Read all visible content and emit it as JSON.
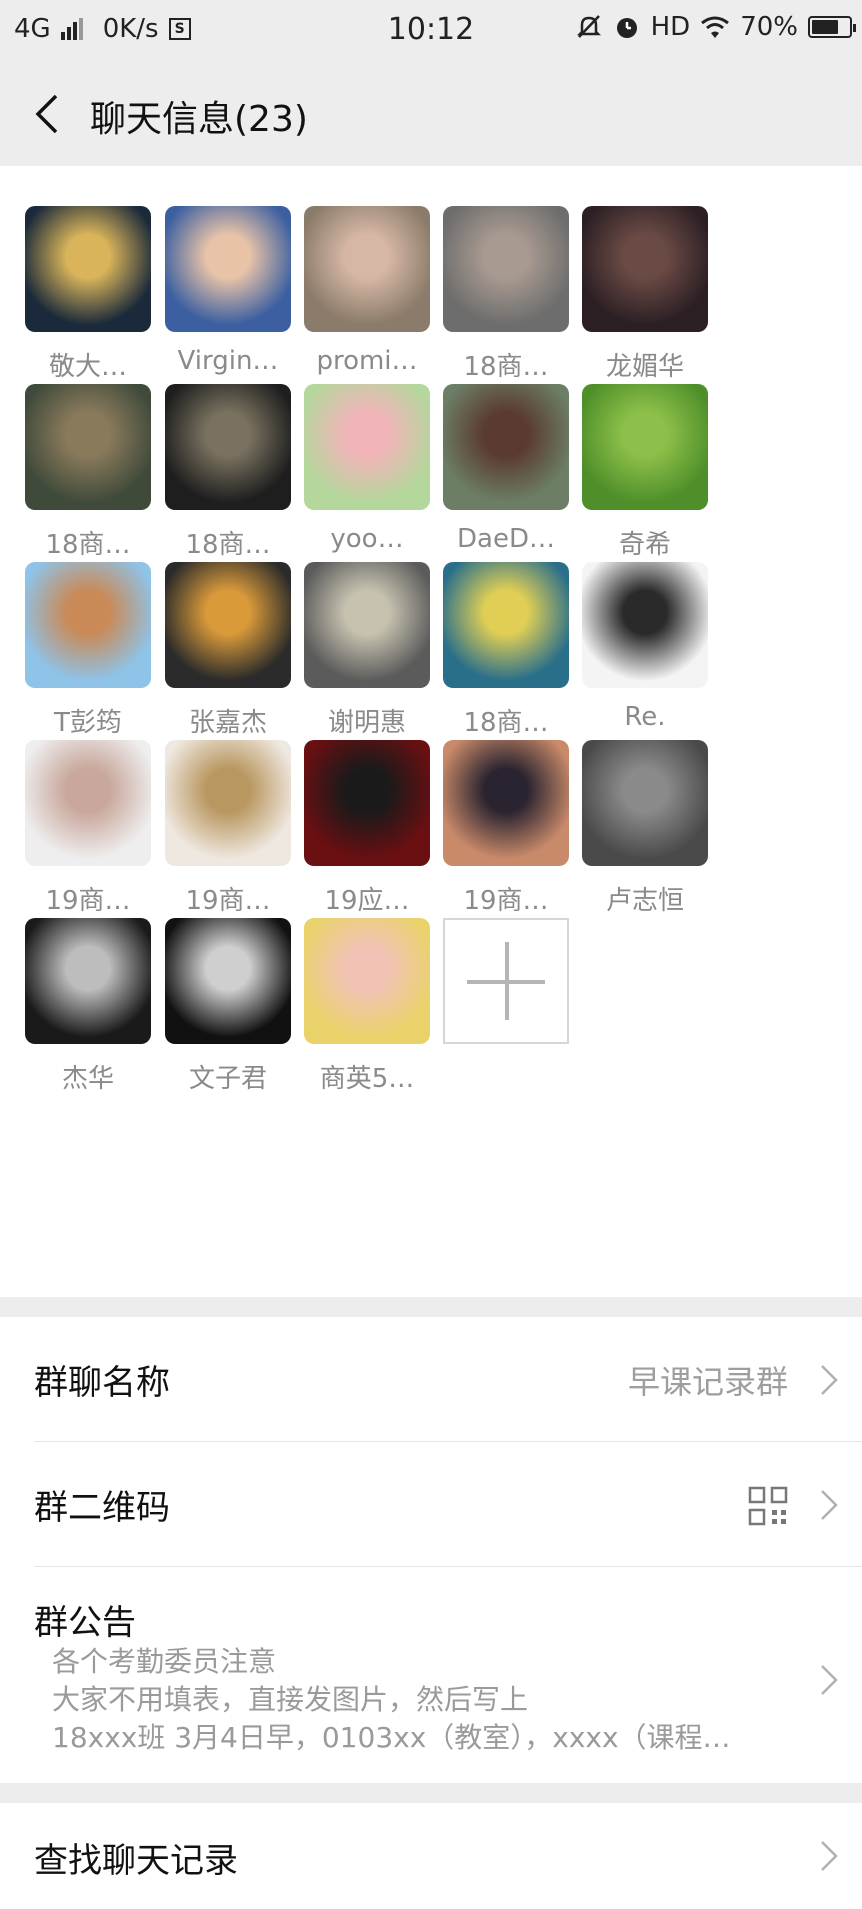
{
  "status": {
    "network": "4G",
    "speed": "0K/s",
    "s_badge": "S",
    "time": "10:12",
    "hd": "HD",
    "battery": "70%"
  },
  "nav": {
    "title": "聊天信息(23)"
  },
  "members": [
    {
      "name": "敬大…",
      "avatar_colors": [
        "#1b2a3a",
        "#d9b45a"
      ]
    },
    {
      "name": "Virgin…",
      "avatar_colors": [
        "#3b5fa0",
        "#e8c3a8"
      ]
    },
    {
      "name": "promi…",
      "avatar_colors": [
        "#8b7b6a",
        "#d6b7a5"
      ]
    },
    {
      "name": "18商…",
      "avatar_colors": [
        "#6d6d6d",
        "#a89a90"
      ]
    },
    {
      "name": "龙媚华",
      "avatar_colors": [
        "#2b1f24",
        "#6a4a44"
      ]
    },
    {
      "name": "18商…",
      "avatar_colors": [
        "#3f4a3a",
        "#8a7a5c"
      ]
    },
    {
      "name": "18商…",
      "avatar_colors": [
        "#1e1e1e",
        "#7a7260"
      ]
    },
    {
      "name": "yoo…",
      "avatar_colors": [
        "#b4d79c",
        "#f1b5b9"
      ]
    },
    {
      "name": "DaeD…",
      "avatar_colors": [
        "#6c7f66",
        "#5a3a32"
      ]
    },
    {
      "name": "奇希",
      "avatar_colors": [
        "#4f8f2a",
        "#8dc04a"
      ]
    },
    {
      "name": "T彭筠",
      "avatar_colors": [
        "#8fc3e8",
        "#c98a58"
      ]
    },
    {
      "name": "张嘉杰",
      "avatar_colors": [
        "#2a2b2a",
        "#d99a3a"
      ]
    },
    {
      "name": "谢明惠",
      "avatar_colors": [
        "#5b5b5b",
        "#c7c2b0"
      ]
    },
    {
      "name": "18商…",
      "avatar_colors": [
        "#2a6f8a",
        "#e0cf54"
      ]
    },
    {
      "name": "Re.",
      "avatar_colors": [
        "#f4f4f4",
        "#2a2a2a"
      ]
    },
    {
      "name": "19商…",
      "avatar_colors": [
        "#eeeeee",
        "#c9a79c"
      ]
    },
    {
      "name": "19商…",
      "avatar_colors": [
        "#efe8e0",
        "#b99760"
      ]
    },
    {
      "name": "19应…",
      "avatar_colors": [
        "#6a0f12",
        "#1a1a1a"
      ]
    },
    {
      "name": "19商…",
      "avatar_colors": [
        "#c98a6a",
        "#2a2430"
      ]
    },
    {
      "name": "卢志恒",
      "avatar_colors": [
        "#4a4a4a",
        "#8a8a8a"
      ]
    },
    {
      "name": "杰华",
      "avatar_colors": [
        "#1a1a1a",
        "#bdbdbd"
      ]
    },
    {
      "name": "文子君",
      "avatar_colors": [
        "#111111",
        "#cfcfcf"
      ]
    },
    {
      "name": "商英5…",
      "avatar_colors": [
        "#e9d26a",
        "#f2c3b5"
      ]
    }
  ],
  "settings": {
    "group_name_label": "群聊名称",
    "group_name_value": "早课记录群",
    "qr_label": "群二维码",
    "notice_label": "群公告",
    "notice_lines": [
      "各个考勤委员注意",
      "大家不用填表，直接发图片，然后写上",
      "18xxx班  3月4日早，0103xx（教室），xxxx（课程…"
    ],
    "search_label": "查找聊天记录"
  }
}
